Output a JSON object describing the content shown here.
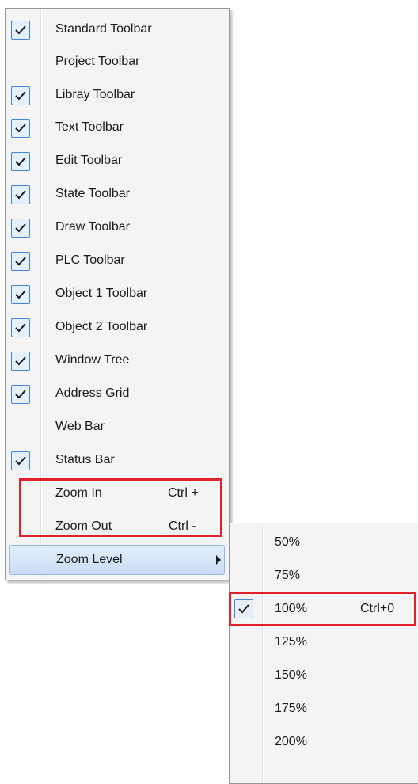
{
  "menu": {
    "items": [
      {
        "label": "Standard Toolbar",
        "checked": true
      },
      {
        "label": "Project Toolbar",
        "checked": false
      },
      {
        "label": "Libray Toolbar",
        "checked": true
      },
      {
        "label": "Text Toolbar",
        "checked": true
      },
      {
        "label": "Edit Toolbar",
        "checked": true
      },
      {
        "label": "State Toolbar",
        "checked": true
      },
      {
        "label": "Draw Toolbar",
        "checked": true
      },
      {
        "label": "PLC Toolbar",
        "checked": true
      },
      {
        "label": "Object 1 Toolbar",
        "checked": true
      },
      {
        "label": "Object 2 Toolbar",
        "checked": true
      },
      {
        "label": "Window Tree",
        "checked": true
      },
      {
        "label": "Address Grid",
        "checked": true
      },
      {
        "label": "Web Bar",
        "checked": false
      },
      {
        "label": "Status Bar",
        "checked": true
      }
    ],
    "zoom_in": {
      "label": "Zoom In",
      "shortcut": "Ctrl +"
    },
    "zoom_out": {
      "label": "Zoom Out",
      "shortcut": "Ctrl -"
    },
    "zoom_level": {
      "label": "Zoom Level"
    }
  },
  "submenu": {
    "items": [
      {
        "label": "50%",
        "checked": false,
        "shortcut": ""
      },
      {
        "label": "75%",
        "checked": false,
        "shortcut": ""
      },
      {
        "label": "100%",
        "checked": true,
        "shortcut": "Ctrl+0"
      },
      {
        "label": "125%",
        "checked": false,
        "shortcut": ""
      },
      {
        "label": "150%",
        "checked": false,
        "shortcut": ""
      },
      {
        "label": "175%",
        "checked": false,
        "shortcut": ""
      },
      {
        "label": "200%",
        "checked": false,
        "shortcut": ""
      }
    ]
  },
  "colors": {
    "check_border": "#3d86d9",
    "highlight": "#e0202a"
  }
}
